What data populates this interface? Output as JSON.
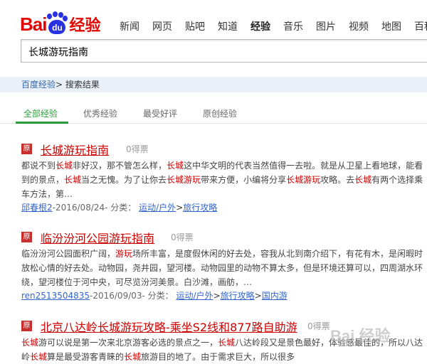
{
  "logo": {
    "text1": "Bai",
    "text2": "du",
    "text3": "经验"
  },
  "nav": [
    "新闻",
    "网页",
    "贴吧",
    "知道",
    "经验",
    "音乐",
    "图片",
    "视频",
    "地图",
    "百科"
  ],
  "nav_active": "经验",
  "search": {
    "value": "长城游玩指南"
  },
  "breadcrumb": {
    "home": "百度经验",
    "separator": ">",
    "current": "搜索结果"
  },
  "tabs": [
    "全部经验",
    "优秀经验",
    "最受好评",
    "原创经验"
  ],
  "badge": "原",
  "results": [
    {
      "title_pre": "长城游玩指南",
      "title_post": "",
      "votes": "0得票",
      "desc": "都说不到长城非好汉，那不管怎么样，长城这中华文明的代表当然值得一去啦。就是从卫星上看地球，能看到的景点，长城当之无愧。为了让你去长城游玩带来方便，小编将分享长城游玩攻略。去长城有两个选择乘车方法，第…",
      "author": "邱春根2",
      "date": "-2016/08/24-",
      "category_label": "分类：",
      "categories": [
        "运动/户外",
        "旅行攻略"
      ]
    },
    {
      "title_pre": "临汾汾河公园",
      "title_post": "游玩指南",
      "votes": "0得票",
      "desc": "临汾汾河公园面积广阔，游玩场所丰富，是度假休闲的好去处，容我从北到南介绍下，有花有木，是闲暇时放松心情的好去处。动物园，尧井园，望河楼。动物园里的动物不算太多，但是环境还算可以，四周湖水环绕，望河楼位于河中央，可尽览汾河美景。白沙滩，画舫，…",
      "author": "ren2513504835",
      "date": "-2016/09/03-",
      "category_label": "分类：",
      "categories": [
        "运动/户外",
        "旅行攻略",
        "国内游"
      ]
    },
    {
      "title_pre": "北京八达岭长城游玩攻略-乘坐S2线和877路自助游",
      "title_post": "",
      "votes": "0得票",
      "desc": "长城游可以说是第一次来北京游客必选的景点之一，长城八达岭段又是景色最好，体验感最佳的，所以八达岭长城算是最受游客青睐的长城旅游目的地了。由于需求巨大，所以很多",
      "author": "",
      "date": "",
      "category_label": "",
      "categories": []
    }
  ],
  "watermark": "Bai 经验"
}
